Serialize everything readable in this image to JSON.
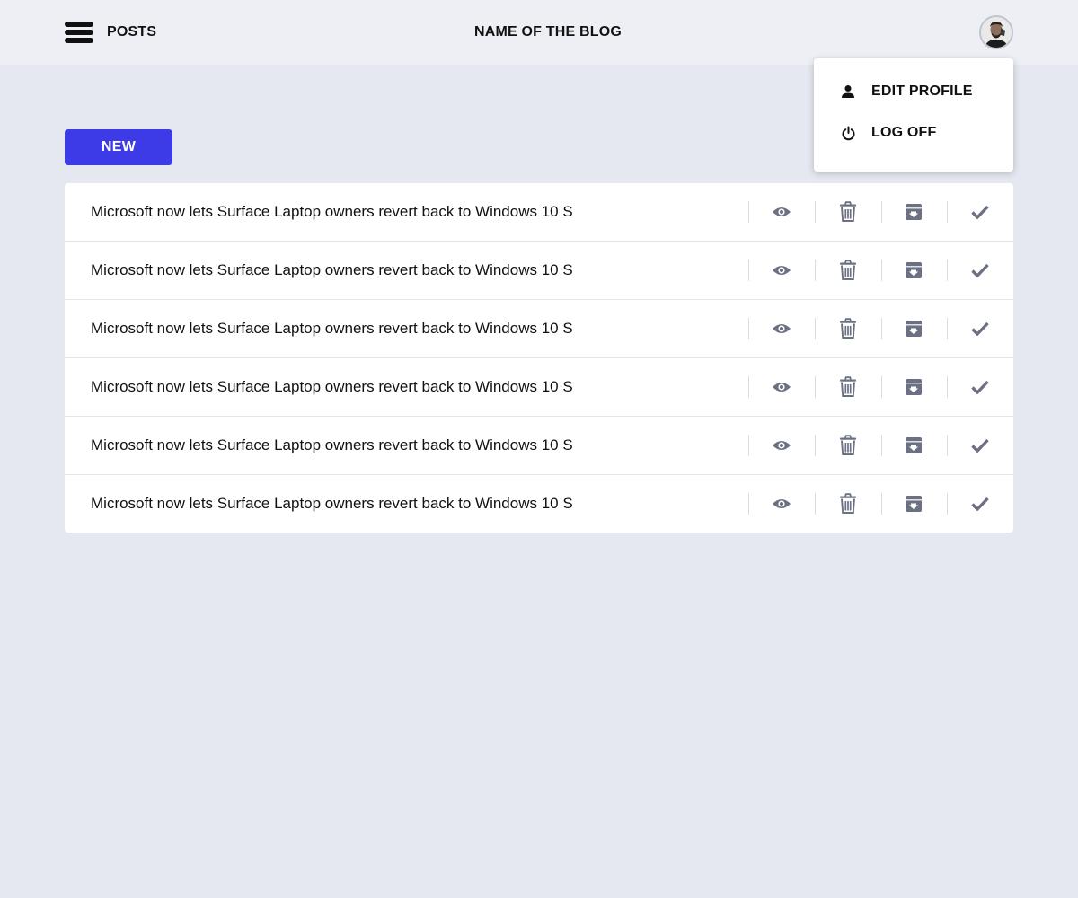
{
  "header": {
    "menu_icon": "hamburger-menu-icon",
    "nav_label": "POSTS",
    "blog_title": "NAME OF THE BLOG",
    "avatar_icon": "user-avatar"
  },
  "dropdown": {
    "items": [
      {
        "label": "EDIT PROFILE",
        "icon": "person-icon"
      },
      {
        "label": "LOG OFF",
        "icon": "power-icon"
      }
    ]
  },
  "toolbar": {
    "new_label": "NEW"
  },
  "posts": [
    {
      "title": "Microsoft now lets Surface Laptop owners revert back to Windows 10 S"
    },
    {
      "title": "Microsoft now lets Surface Laptop owners revert back to Windows 10 S"
    },
    {
      "title": "Microsoft now lets Surface Laptop owners revert back to Windows 10 S"
    },
    {
      "title": "Microsoft now lets Surface Laptop owners revert back to Windows 10 S"
    },
    {
      "title": "Microsoft now lets Surface Laptop owners revert back to Windows 10 S"
    },
    {
      "title": "Microsoft now lets Surface Laptop owners revert back to Windows 10 S"
    }
  ],
  "row_actions": [
    "view-icon",
    "trash-icon",
    "archive-icon",
    "check-icon"
  ],
  "colors": {
    "accent": "#3D3AE8",
    "background": "#E5E8F0",
    "header_background": "#EEEFF4",
    "icon_gray": "#6B7083",
    "text": "#111111"
  }
}
